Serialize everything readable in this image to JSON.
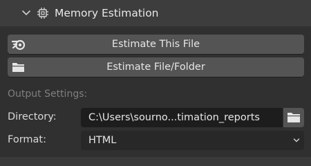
{
  "panel": {
    "title": "Memory Estimation",
    "expand_icon": "chevron-down-icon",
    "panel_icon": "chip-icon"
  },
  "buttons": {
    "estimate_file": {
      "label": "Estimate This File",
      "icon": "blender-logo-icon"
    },
    "estimate_folder": {
      "label": "Estimate File/Folder",
      "icon": "folder-icon"
    }
  },
  "output_settings": {
    "section_label": "Output Settings:",
    "directory": {
      "label": "Directory:",
      "value": "C:\\Users\\sourno...timation_reports",
      "browse_icon": "folder-icon"
    },
    "format": {
      "label": "Format:",
      "value": "HTML",
      "icon": "chevron-down-icon"
    }
  },
  "colors": {
    "panel_bg": "#303030",
    "header_bg": "#3d3d3d",
    "button_bg": "#545454",
    "field_bg": "#1d1d1d",
    "text": "#e6e6e6",
    "muted_text": "#7f7f7f"
  }
}
